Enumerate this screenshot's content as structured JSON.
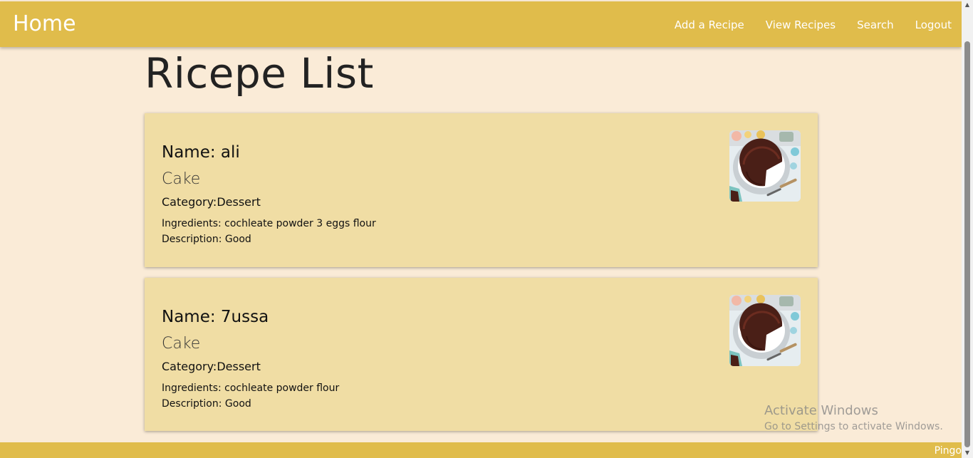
{
  "navbar": {
    "brand": "Home",
    "links": [
      "Add a Recipe",
      "View Recipes",
      "Search",
      "Logout"
    ]
  },
  "page": {
    "title": "Ricepe List"
  },
  "recipes": [
    {
      "name": "Name: ali",
      "title": "Cake",
      "category": "Category:Dessert",
      "ingredients": "Ingredients: cochleate powder 3 eggs flour",
      "description": "Description: Good",
      "image": "chocolate-cake-photo"
    },
    {
      "name": "Name: 7ussa",
      "title": "Cake",
      "category": "Category:Dessert",
      "ingredients": "Ingredients: cochleate powder flour",
      "description": "Description: Good",
      "image": "chocolate-cake-photo"
    }
  ],
  "watermark": {
    "title": "Activate Windows",
    "subtitle": "Go to Settings to activate Windows."
  },
  "footer": {
    "text": "Pingo"
  },
  "colors": {
    "navbar": "#e0bc4b",
    "background": "#faebd7",
    "card": "#f0dda4"
  },
  "scrollbar": {
    "up_icon": "▲",
    "down_icon": "▼"
  }
}
